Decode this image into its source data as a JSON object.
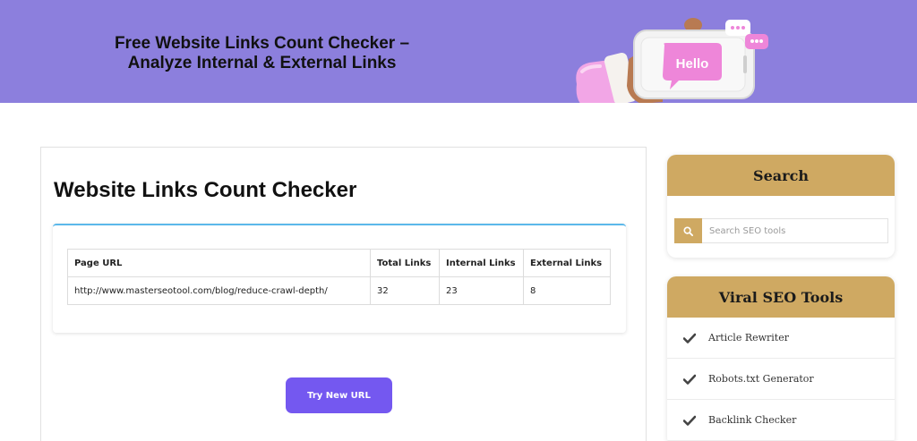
{
  "hero": {
    "title_line1": "Free Website Links Count Checker –",
    "title_line2": "Analyze Internal & External Links",
    "illustration_text": "Hello",
    "background_color": "#8c7fdd"
  },
  "main": {
    "title": "Website Links Count Checker",
    "table": {
      "headers": [
        "Page URL",
        "Total Links",
        "Internal Links",
        "External Links"
      ],
      "rows": [
        [
          "http://www.masterseotool.com/blog/reduce-crawl-depth/",
          "32",
          "23",
          "8"
        ]
      ]
    },
    "try_button_label": "Try New URL",
    "button_color": "#7458f0",
    "accent_color": "#5bb8ea"
  },
  "sidebar": {
    "accent_color": "#cfa962",
    "search": {
      "title": "Search",
      "placeholder": "Search SEO tools",
      "icon": "search-icon"
    },
    "tools": {
      "title": "Viral SEO Tools",
      "icon": "check-icon",
      "items": [
        {
          "label": "Article Rewriter"
        },
        {
          "label": "Robots.txt Generator"
        },
        {
          "label": "Backlink Checker"
        }
      ]
    }
  }
}
